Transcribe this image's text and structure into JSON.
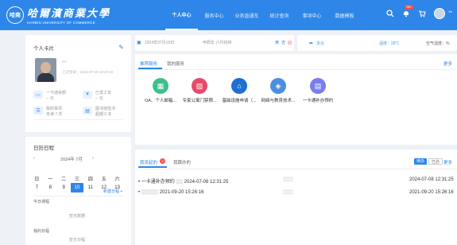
{
  "header": {
    "logo_seal": "哈商",
    "logo_cn": "哈爾濱商業大學",
    "logo_en": "HARBIN UNIVERSITY OF COMMERCE",
    "nav": [
      "个人中心",
      "服务中心",
      "业务直通车",
      "统计查询",
      "事项中心",
      "数据模板"
    ],
    "active_nav": 0,
    "notice_badge": "99+",
    "user_name": "**"
  },
  "profile": {
    "title": "个人卡片",
    "name": "**",
    "last_login": "上次登录：2024-07-19 13:20:42",
    "items": [
      {
        "icon": "card-icon",
        "line1": "一卡通余额",
        "line2": "-- 元"
      },
      {
        "icon": "salary-icon",
        "line1": "已发工资",
        "line2": "-- 元"
      },
      {
        "icon": "task-icon",
        "line1": "我的事项",
        "line2": "未读 7 件"
      },
      {
        "icon": "book-icon",
        "line1": "图书馆借书",
        "line2": "超期 0 本"
      }
    ]
  },
  "calendar": {
    "title": "日历日程",
    "month_label": "2024年  7月",
    "weekdays": [
      "日",
      "一",
      "二",
      "三",
      "四",
      "五",
      "六"
    ],
    "days": [
      "7",
      "8",
      "9",
      "10",
      "11",
      "12",
      "13"
    ],
    "today_index": 3,
    "new_schedule": "新建日程 +",
    "today_course": "今日课程",
    "no_data_1": "暂无数据",
    "my_schedule": "我的日程",
    "no_data_2": "暂无日程"
  },
  "status_bar": {
    "date": "2024年07月19日",
    "lunar": "甲辰年 六月初四",
    "tags": [
      "黄",
      "吉",
      "凶"
    ],
    "weather": "多云",
    "temp": "温度：28℃",
    "humidity": "空气湿度：%"
  },
  "services": {
    "tabs": [
      "推荐服务",
      "我的服务"
    ],
    "more": "更多",
    "items": [
      {
        "icon": "oa-icon",
        "label": "OA、个人邮箱...",
        "color": "#3fbf8c"
      },
      {
        "icon": "image-icon",
        "label": "专家公寓门禁照...",
        "color": "#e84a6a"
      },
      {
        "icon": "bank-icon",
        "label": "基础设施申请（...",
        "color": "#1f6fd0"
      },
      {
        "icon": "network-icon",
        "label": "网络与教育技术...",
        "color": "#4c8fe0"
      },
      {
        "icon": "card-apply-icon",
        "label": "一卡通补办预约",
        "color": "#7a7cf0"
      }
    ]
  },
  "matters": {
    "tabs": [
      "我发起的",
      "我跟办的"
    ],
    "tab_badge": "2",
    "buttons": [
      "待办",
      "已办",
      "更多"
    ],
    "rows": [
      {
        "title": "一卡通补办预约",
        "time1": "2024-07-08 12:31:25",
        "time2": "2024-07-08 12:31:25"
      },
      {
        "title": "",
        "time1": "2021-09-20 15:26:16",
        "time2": "2021-09-20 15:26:16"
      }
    ]
  }
}
